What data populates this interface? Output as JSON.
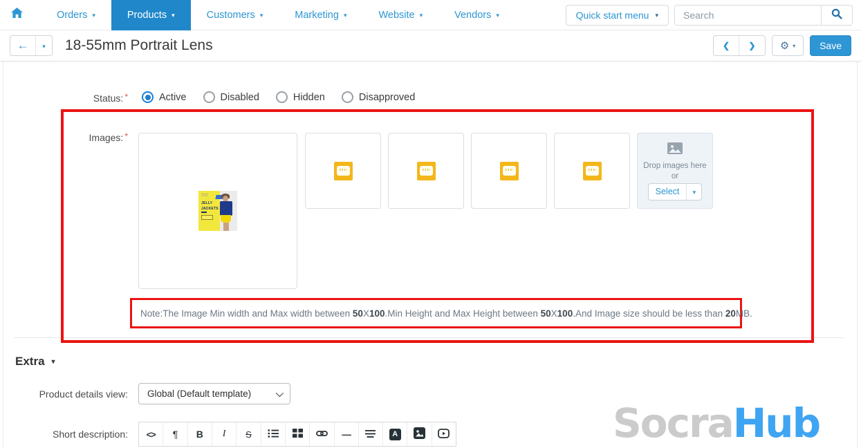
{
  "icons": {
    "caret_down": "▾",
    "chevron_left": "❮",
    "chevron_right": "❯",
    "back_arrow": "←",
    "gear": "⚙"
  },
  "nav": {
    "items": [
      {
        "label": "Orders"
      },
      {
        "label": "Products"
      },
      {
        "label": "Customers"
      },
      {
        "label": "Marketing"
      },
      {
        "label": "Website"
      },
      {
        "label": "Vendors"
      }
    ],
    "active_item": "Products",
    "quick_start_label": "Quick start menu",
    "search_placeholder": "Search"
  },
  "header": {
    "title": "18-55mm Portrait Lens",
    "save_label": "Save"
  },
  "form": {
    "required_mark": "*",
    "status": {
      "label": "Status:",
      "options": [
        "Active",
        "Disabled",
        "Hidden",
        "Disapproved"
      ],
      "selected": "Active"
    },
    "images": {
      "label": "Images:",
      "thumbnail": {
        "line1": "JELLY",
        "line2": "JACKETS"
      },
      "dropzone": {
        "line1": "Drop images here",
        "line2": "or",
        "select_label": "Select"
      },
      "note": {
        "segments": [
          {
            "text": "Note:The Image Min width and Max width between ",
            "bold": false
          },
          {
            "text": "50",
            "bold": true
          },
          {
            "text": "X",
            "bold": false
          },
          {
            "text": "100",
            "bold": true
          },
          {
            "text": ".Min Height and Max Height between ",
            "bold": false
          },
          {
            "text": "50",
            "bold": true
          },
          {
            "text": "X",
            "bold": false
          },
          {
            "text": "100",
            "bold": true
          },
          {
            "text": ".And Image size should be less than ",
            "bold": false
          },
          {
            "text": "20",
            "bold": true
          },
          {
            "text": "MB.",
            "bold": false
          }
        ]
      }
    },
    "extra": {
      "heading": "Extra",
      "product_details_view": {
        "label": "Product details view:",
        "value": "Global (Default template)"
      },
      "short_description": {
        "label": "Short description:",
        "toolbar_icons": [
          "code-icon",
          "paragraph-icon",
          "bold-icon",
          "italic-icon",
          "strikethrough-icon",
          "list-icon",
          "table-icon",
          "link-icon",
          "horizontal-rule-icon",
          "align-icon",
          "font-block-icon",
          "image-block-icon",
          "video-icon"
        ],
        "glyphs": {
          "code": "<>",
          "pilcrow": "¶",
          "bold": "B",
          "italic": "I",
          "strike": "S",
          "hr": "—",
          "font_block": "A"
        }
      }
    }
  },
  "watermark": {
    "gray": "Socra",
    "blue": "Hub"
  },
  "colors": {
    "accent_blue": "#2d96d2",
    "active_tab": "#2187cb",
    "save_button": "#2e96d4",
    "highlight_red": "#ea1313",
    "radio_selected": "#1d7fd4",
    "watermark_blue": "#3fa5f2"
  }
}
